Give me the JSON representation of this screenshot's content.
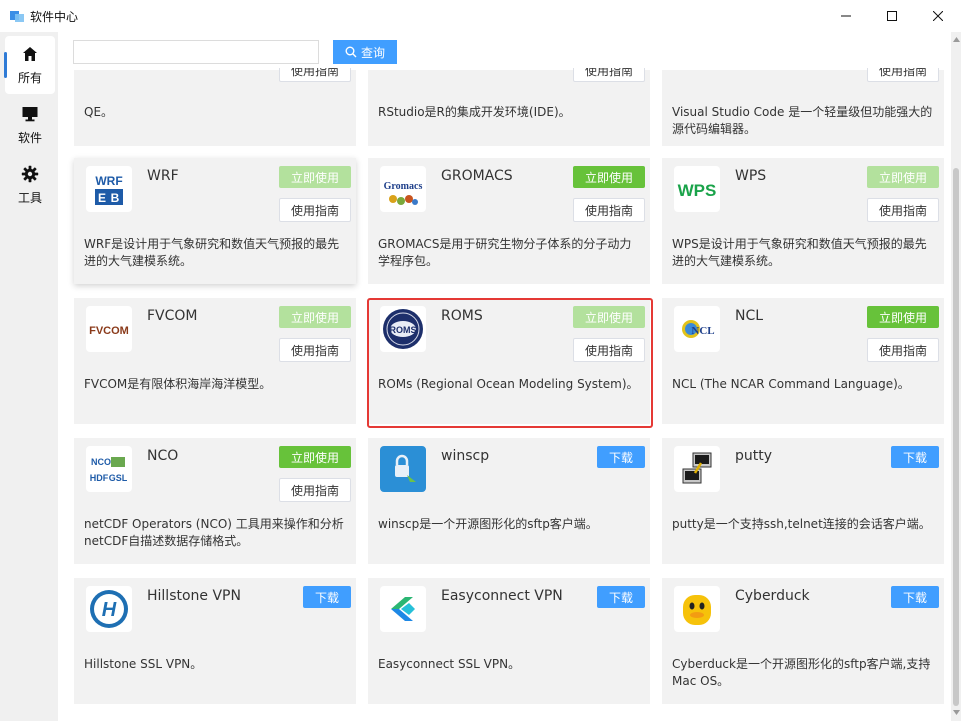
{
  "window": {
    "title": "软件中心"
  },
  "sidebar": {
    "items": [
      {
        "label": "所有",
        "icon": "home-icon",
        "active": true
      },
      {
        "label": "软件",
        "icon": "monitor-icon",
        "active": false
      },
      {
        "label": "工具",
        "icon": "gear-icon",
        "active": false
      }
    ]
  },
  "search": {
    "placeholder": "",
    "value": "",
    "button_label": "查询"
  },
  "buttons": {
    "use": "立即使用",
    "guide": "使用指南",
    "download": "下载"
  },
  "cards": [
    {
      "id": "qe",
      "name": "",
      "desc": "QE。",
      "partial": true
    },
    {
      "id": "rstudio",
      "name": "",
      "desc": "RStudio是R的集成开发环境(IDE)。",
      "partial": true
    },
    {
      "id": "vscode",
      "name": "",
      "desc": "Visual Studio Code 是一个轻量级但功能强大的源代码编辑器。",
      "partial": true
    },
    {
      "id": "wrf",
      "name": "WRF",
      "desc": "WRF是设计用于气象研究和数值天气预报的最先进的大气建模系统。",
      "use_enabled": false
    },
    {
      "id": "gromacs",
      "name": "GROMACS",
      "desc": "GROMACS是用于研究生物分子体系的分子动力学程序包。",
      "use_enabled": true
    },
    {
      "id": "wps",
      "name": "WPS",
      "desc": "WPS是设计用于气象研究和数值天气预报的最先进的大气建模系统。",
      "use_enabled": false
    },
    {
      "id": "fvcom",
      "name": "FVCOM",
      "desc": "FVCOM是有限体积海岸海洋模型。",
      "use_enabled": false
    },
    {
      "id": "roms",
      "name": "ROMS",
      "desc": "ROMs (Regional Ocean Modeling System)。",
      "use_enabled": false
    },
    {
      "id": "ncl",
      "name": "NCL",
      "desc": "NCL (The NCAR Command Language)。",
      "use_enabled": true
    },
    {
      "id": "nco",
      "name": "NCO",
      "desc": "netCDF Operators (NCO) 工具用来操作和分析netCDF自描述数据存储格式。",
      "use_enabled": true
    },
    {
      "id": "winscp",
      "name": "winscp",
      "desc": "winscp是一个开源图形化的sftp客户端。",
      "download": true
    },
    {
      "id": "putty",
      "name": "putty",
      "desc": "putty是一个支持ssh,telnet连接的会话客户端。",
      "download": true
    },
    {
      "id": "hillstone",
      "name": "Hillstone VPN",
      "desc": "Hillstone SSL VPN。",
      "download": true
    },
    {
      "id": "easyconnect",
      "name": "Easyconnect VPN",
      "desc": "Easyconnect SSL VPN。",
      "download": true
    },
    {
      "id": "cyberduck",
      "name": "Cyberduck",
      "desc": "Cyberduck是一个开源图形化的sftp客户端,支持Mac OS。",
      "download": true
    }
  ],
  "logos": {
    "wrf": "WRF",
    "wps": "WPS",
    "fvcom": "FVCOM",
    "ncl": "NCL",
    "nco": "NCO",
    "roms": "ROMS",
    "gromacs": "Gromacs"
  },
  "colors": {
    "accent": "#409eff",
    "use_enabled": "#67c23a",
    "use_disabled": "#b3e19d",
    "highlight": "#e53935"
  }
}
